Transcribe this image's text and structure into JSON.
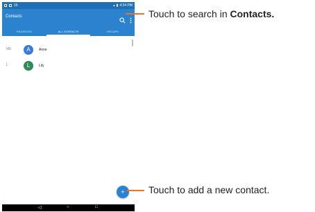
{
  "statusbar": {
    "left_icons": [
      "notification-icon",
      "image-icon",
      "text-icon"
    ],
    "left_text": "15",
    "right_icons": [
      "signal-icon",
      "battery-icon"
    ],
    "time": "4:34 PM"
  },
  "appbar": {
    "title": "Contacts",
    "search_icon": "search-icon",
    "more_icon": "more-vert-icon"
  },
  "tabs": [
    {
      "label": "FAVORITES",
      "active": false
    },
    {
      "label": "ALL CONTACTS",
      "active": true
    },
    {
      "label": "GROUPS",
      "active": false
    }
  ],
  "contacts": [
    {
      "section": "ME",
      "initial": "A",
      "name": "Anne",
      "color": "#3a7ad9"
    },
    {
      "section": "L",
      "initial": "L",
      "name": "Lily",
      "color": "#2e8b57"
    }
  ],
  "fab": {
    "icon": "add-contact-icon",
    "label": "+"
  },
  "navbar": {
    "back": "◁",
    "home": "○",
    "recents": "□"
  },
  "callouts": {
    "search_text": "Touch to search in ",
    "search_bold": "Contacts.",
    "add_text": "Touch to add a new contact."
  },
  "colors": {
    "primary": "#2b83cf",
    "statusbar": "#1f6fb5",
    "callout_line": "#e6742b"
  }
}
